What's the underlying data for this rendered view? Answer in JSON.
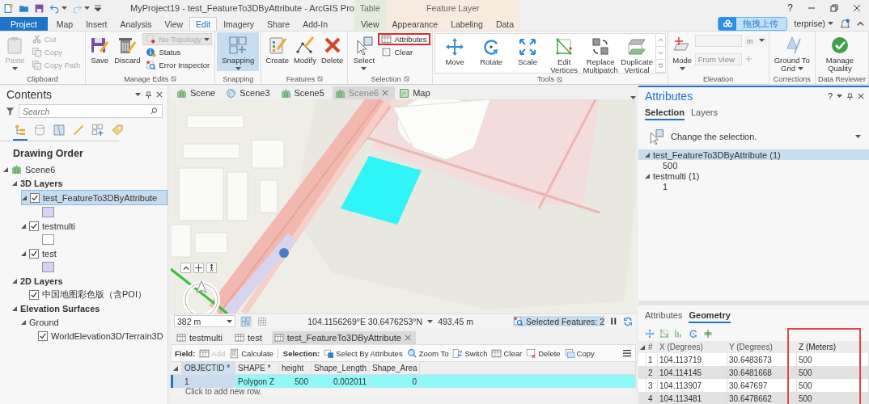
{
  "title_bar": {
    "title": "MyProject19 - test_FeatureTo3DByAttribute - ArcGIS Pro",
    "help": "?"
  },
  "ribbon_tabs": [
    {
      "label": "Project",
      "kind": "backstage",
      "selected": false
    },
    {
      "label": "Map",
      "kind": "tab",
      "selected": false
    },
    {
      "label": "Insert",
      "kind": "tab",
      "selected": false
    },
    {
      "label": "Analysis",
      "kind": "tab",
      "selected": false
    },
    {
      "label": "View",
      "kind": "tab",
      "selected": false
    },
    {
      "label": "Edit",
      "kind": "tab",
      "selected": true
    },
    {
      "label": "Imagery",
      "kind": "tab",
      "selected": false
    },
    {
      "label": "Share",
      "kind": "tab",
      "selected": false
    },
    {
      "label": "Add-In",
      "kind": "tab",
      "selected": false
    }
  ],
  "context_groups": [
    {
      "label": "Table",
      "color": "#e3ecdc",
      "tabs": [
        {
          "label": "View",
          "selected": false
        }
      ]
    },
    {
      "label": "Feature Layer",
      "color": "#f7ebdf",
      "tabs": [
        {
          "label": "Appearance",
          "selected": false
        },
        {
          "label": "Labeling",
          "selected": false
        },
        {
          "label": "Data",
          "selected": false
        }
      ]
    }
  ],
  "upload_button": {
    "label": "拖拽上传"
  },
  "account": {
    "label": "terprise)"
  },
  "ribbon_groups": [
    {
      "label": "Clipboard",
      "kind": "standard",
      "launcher": false,
      "tools": [
        {
          "kind": "large",
          "label": "Paste",
          "disabled": true,
          "dropdown": true,
          "selected": false,
          "outlined": false
        },
        {
          "kind": "small",
          "label": "Cut",
          "disabled": true,
          "dropdown": false,
          "selected": false,
          "outlined": false
        },
        {
          "kind": "small",
          "label": "Copy",
          "disabled": true,
          "dropdown": false,
          "selected": false,
          "outlined": false
        },
        {
          "kind": "small",
          "label": "Copy Path",
          "disabled": true,
          "dropdown": false,
          "selected": false,
          "outlined": false
        }
      ]
    },
    {
      "label": "Manage Edits",
      "kind": "standard",
      "launcher": true,
      "tools": [
        {
          "kind": "large",
          "label": "Save",
          "disabled": false,
          "dropdown": false,
          "selected": false,
          "outlined": false
        },
        {
          "kind": "large",
          "label": "Discard",
          "disabled": false,
          "dropdown": false,
          "selected": false,
          "outlined": false
        },
        {
          "kind": "combo",
          "label": "No Topology",
          "disabled": true,
          "dropdown": true,
          "selected": false,
          "outlined": false
        },
        {
          "kind": "small",
          "label": "Status",
          "disabled": false,
          "dropdown": false,
          "selected": false,
          "outlined": false
        },
        {
          "kind": "small",
          "label": "Error Inspector",
          "disabled": false,
          "dropdown": false,
          "selected": false,
          "outlined": false
        }
      ]
    },
    {
      "label": "Snapping",
      "kind": "standard",
      "launcher": false,
      "tools": [
        {
          "kind": "large",
          "label": "Snapping",
          "disabled": false,
          "dropdown": true,
          "selected": true,
          "outlined": false
        }
      ]
    },
    {
      "label": "Features",
      "kind": "standard",
      "launcher": true,
      "tools": [
        {
          "kind": "large",
          "label": "Create",
          "disabled": false,
          "dropdown": false,
          "selected": false,
          "outlined": false
        },
        {
          "kind": "large",
          "label": "Modify",
          "disabled": false,
          "dropdown": false,
          "selected": false,
          "outlined": false
        },
        {
          "kind": "large",
          "label": "Delete",
          "disabled": false,
          "dropdown": false,
          "selected": false,
          "outlined": false
        }
      ]
    },
    {
      "label": "Selection",
      "kind": "standard",
      "launcher": true,
      "tools": [
        {
          "kind": "large",
          "label": "Select",
          "disabled": false,
          "dropdown": true,
          "selected": false,
          "outlined": false
        },
        {
          "kind": "small",
          "label": "Attributes",
          "disabled": false,
          "dropdown": false,
          "selected": false,
          "outlined": true
        },
        {
          "kind": "small",
          "label": "Clear",
          "disabled": false,
          "dropdown": false,
          "selected": false,
          "outlined": false
        }
      ]
    },
    {
      "label": "Tools",
      "kind": "gallery",
      "launcher": true,
      "tools": [
        {
          "kind": "large",
          "label": "Move",
          "disabled": false,
          "dropdown": false,
          "selected": false,
          "outlined": false
        },
        {
          "kind": "large",
          "label": "Rotate",
          "disabled": false,
          "dropdown": false,
          "selected": false,
          "outlined": false
        },
        {
          "kind": "large",
          "label": "Scale",
          "disabled": false,
          "dropdown": false,
          "selected": false,
          "outlined": false
        },
        {
          "kind": "large",
          "label": "Edit Vertices",
          "disabled": false,
          "dropdown": false,
          "selected": false,
          "outlined": false
        },
        {
          "kind": "large",
          "label": "Replace Multipatch",
          "disabled": false,
          "dropdown": false,
          "selected": false,
          "outlined": false
        },
        {
          "kind": "large",
          "label": "Duplicate Vertical",
          "disabled": false,
          "dropdown": false,
          "selected": false,
          "outlined": false
        }
      ]
    },
    {
      "label": "Elevation",
      "kind": "standard",
      "launcher": false,
      "tools": [
        {
          "kind": "large",
          "label": "Mode",
          "disabled": false,
          "dropdown": true,
          "selected": false,
          "outlined": false
        },
        {
          "kind": "field",
          "unit": "m",
          "adjust_button": false,
          "disabled": true,
          "dropdown": true,
          "selected": false,
          "outlined": false
        },
        {
          "kind": "field",
          "placeholder": "From View",
          "adjust_button": true,
          "disabled": true,
          "dropdown": false,
          "selected": false,
          "outlined": false
        }
      ]
    },
    {
      "label": "Corrections",
      "kind": "standard",
      "launcher": false,
      "tools": [
        {
          "kind": "large",
          "label": "Ground To Grid",
          "disabled": false,
          "dropdown": true,
          "selected": false,
          "outlined": false
        }
      ]
    },
    {
      "label": "Data Reviewer",
      "kind": "standard",
      "launcher": false,
      "tools": [
        {
          "kind": "large",
          "label": "Manage Quality",
          "disabled": false,
          "dropdown": false,
          "selected": false,
          "outlined": false
        }
      ]
    }
  ],
  "contents": {
    "title": "Contents",
    "search_placeholder": "Search",
    "view_buttons": [
      {
        "selected": true
      },
      {
        "selected": false
      },
      {
        "selected": false
      },
      {
        "selected": false
      },
      {
        "selected": false
      },
      {
        "selected": false
      }
    ],
    "heading": "Drawing Order",
    "tree": [
      {
        "label": "Scene6",
        "kind": "scene",
        "expanded": true,
        "children": [
          {
            "label": "3D Layers",
            "kind": "group",
            "expanded": true,
            "children": [
              {
                "label": "test_FeatureTo3DByAttribute",
                "kind": "layer",
                "expanded": true,
                "checked": true,
                "selected": true,
                "color": "#d6d2f7"
              },
              {
                "label": "testmulti",
                "kind": "layer",
                "expanded": true,
                "checked": true,
                "selected": false,
                "color": "#ffffff"
              },
              {
                "label": "test",
                "kind": "layer",
                "expanded": true,
                "checked": true,
                "selected": false,
                "color": "#d6d2f7"
              }
            ]
          },
          {
            "label": "2D Layers",
            "kind": "group",
            "expanded": true,
            "children": [
              {
                "label": "中国地图彩色版（含POI）",
                "kind": "layer",
                "checked": true,
                "selected": false
              }
            ]
          },
          {
            "label": "Elevation Surfaces",
            "kind": "group",
            "expanded": true,
            "children": [
              {
                "label": "Ground",
                "kind": "surface",
                "expanded": true,
                "children": [
                  {
                    "label": "WorldElevation3D/Terrain3D",
                    "kind": "layer",
                    "checked": true,
                    "selected": false
                  }
                ]
              }
            ]
          }
        ]
      }
    ]
  },
  "views": {
    "tabs": [
      {
        "label": "Scene",
        "kind": "scene",
        "selected": false
      },
      {
        "label": "Scene3",
        "kind": "globe",
        "selected": false
      },
      {
        "label": "Scene5",
        "kind": "scene",
        "selected": false
      },
      {
        "label": "Scene6",
        "kind": "scene",
        "selected": true
      },
      {
        "label": "Map",
        "kind": "map",
        "selected": false
      }
    ],
    "scale": "382 m",
    "coordinates": "104.1156269°E 30.6476253°N",
    "elevation": "493.45 m",
    "selected_features": "Selected Features: 2"
  },
  "table": {
    "tabs": [
      {
        "label": "testmulti",
        "selected": false
      },
      {
        "label": "test",
        "selected": false
      },
      {
        "label": "test_FeatureTo3DByAttribute",
        "selected": true
      }
    ],
    "toolbar": [
      {
        "kind": "label",
        "label": "Field:",
        "disabled": false
      },
      {
        "kind": "button",
        "label": "Add",
        "disabled": true
      },
      {
        "kind": "button",
        "label": "Calculate",
        "disabled": false
      },
      {
        "kind": "label",
        "label": "Selection:",
        "disabled": false
      },
      {
        "kind": "button",
        "label": "Select By Attributes",
        "disabled": false
      },
      {
        "kind": "button",
        "label": "Zoom To",
        "disabled": false
      },
      {
        "kind": "button",
        "label": "Switch",
        "disabled": false
      },
      {
        "kind": "button",
        "label": "Clear",
        "disabled": false
      },
      {
        "kind": "button",
        "label": "Delete",
        "disabled": false
      },
      {
        "kind": "button",
        "label": "Copy",
        "disabled": false
      }
    ],
    "columns": [
      {
        "label": "OBJECTID *",
        "kind": "text"
      },
      {
        "label": "SHAPE *",
        "kind": "text"
      },
      {
        "label": "height",
        "kind": "number"
      },
      {
        "label": "Shape_Length",
        "kind": "number"
      },
      {
        "label": "Shape_Area",
        "kind": "number"
      }
    ],
    "rows": [
      {
        "cells": [
          "1",
          "Polygon Z",
          "500",
          "0.002011",
          "0"
        ],
        "selected": true
      }
    ],
    "new_row_hint": "Click to add new row."
  },
  "attributes": {
    "title": "Attributes",
    "help": "?",
    "tabs": [
      {
        "label": "Selection",
        "selected": true
      },
      {
        "label": "Layers",
        "selected": false
      }
    ],
    "prompt": "Change the selection.",
    "tree": [
      {
        "label": "test_FeatureTo3DByAttribute (1)",
        "selected": true,
        "expanded": true,
        "children": [
          "500"
        ]
      },
      {
        "label": "testmulti (1)",
        "selected": false,
        "expanded": true,
        "children": [
          "1"
        ]
      }
    ],
    "detail_tabs": [
      {
        "label": "Attributes",
        "selected": false
      },
      {
        "label": "Geometry",
        "selected": true
      }
    ],
    "geometry": {
      "columns": [
        {
          "label": "#",
          "outlined": false
        },
        {
          "label": "X (Degrees)",
          "outlined": false
        },
        {
          "label": "Y (Degrees)",
          "outlined": false
        },
        {
          "label": "Z (Meters)",
          "outlined": true
        }
      ],
      "rows": [
        [
          "1",
          "104.113719",
          "30.6483673",
          "500"
        ],
        [
          "2",
          "104.114145",
          "30.6481668",
          "500"
        ],
        [
          "3",
          "104.113907",
          "30.647697",
          "500"
        ],
        [
          "4",
          "104.113481",
          "30.6478662",
          "500"
        ]
      ]
    }
  }
}
